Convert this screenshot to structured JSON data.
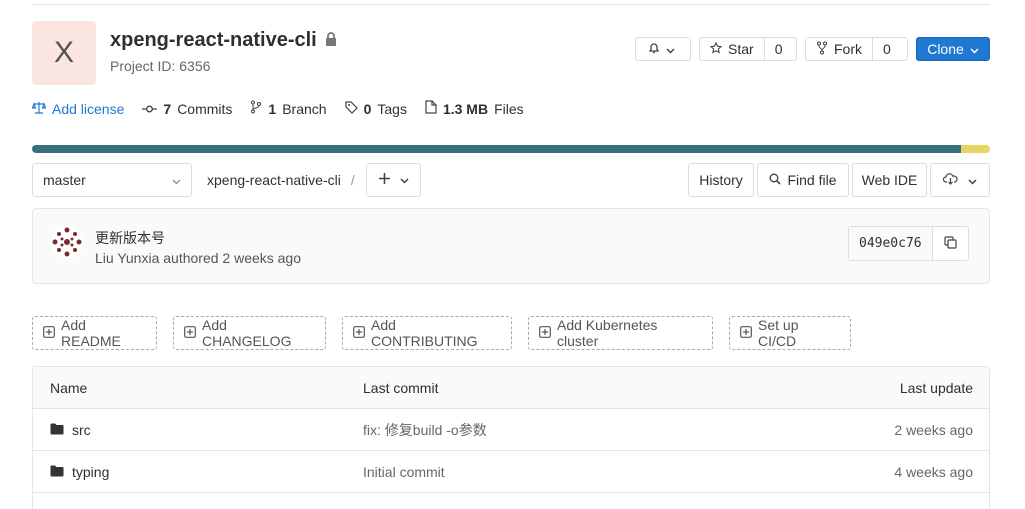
{
  "project": {
    "avatar_letter": "X",
    "name": "xpeng-react-native-cli",
    "id_label": "Project ID: 6356"
  },
  "header_buttons": {
    "star_label": "Star",
    "star_count": "0",
    "fork_label": "Fork",
    "fork_count": "0",
    "clone_label": "Clone"
  },
  "stats": {
    "add_license": "Add license",
    "commits_count": "7",
    "commits_label": "Commits",
    "branches_count": "1",
    "branches_label": "Branch",
    "tags_count": "0",
    "tags_label": "Tags",
    "files_size": "1.3 MB",
    "files_label": "Files"
  },
  "tree": {
    "branch": "master",
    "crumb_root": "xpeng-react-native-cli",
    "crumb_sep": "/",
    "history": "History",
    "find_file": "Find file",
    "web_ide": "Web IDE"
  },
  "last_commit": {
    "title": "更新版本号",
    "meta": "Liu Yunxia authored 2 weeks ago",
    "sha": "049e0c76"
  },
  "suggestions": [
    "Add README",
    "Add CHANGELOG",
    "Add CONTRIBUTING",
    "Add Kubernetes cluster",
    "Set up CI/CD"
  ],
  "table": {
    "headers": {
      "name": "Name",
      "last_commit": "Last commit",
      "last_update": "Last update"
    },
    "rows": [
      {
        "name": "src",
        "commit": "fix: 修复build -o参数",
        "updated": "2 weeks ago"
      },
      {
        "name": "typing",
        "commit": "Initial commit",
        "updated": "4 weeks ago"
      }
    ]
  },
  "colors": {
    "language_primary": "#3a6f7e",
    "language_secondary": "#e8d563",
    "accent": "#1f78d1"
  }
}
